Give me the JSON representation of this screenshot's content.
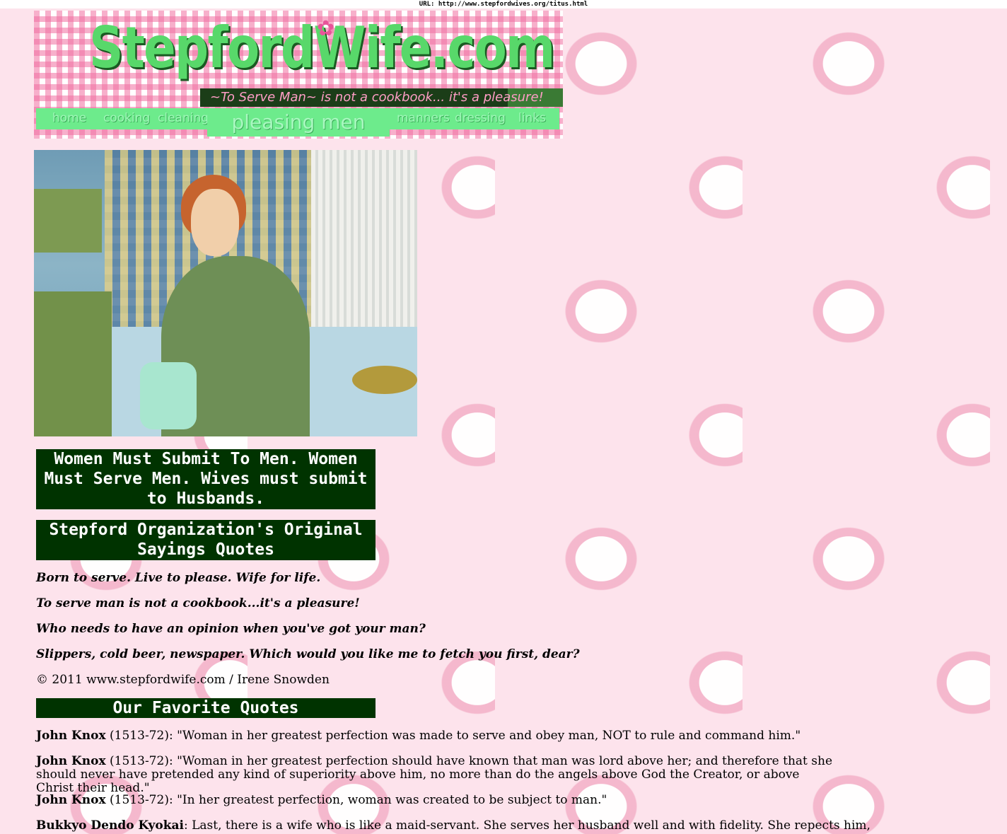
{
  "url_bar": "URL: http://www.stepfordwives.org/titus.html",
  "header": {
    "logo": "StepfordWife.com",
    "tagline": "~To Serve Man~ is not a cookbook... it's a pleasure!",
    "nav": [
      "home",
      "cooking",
      "cleaning",
      "pleasing men",
      "manners",
      "dressing",
      "links"
    ],
    "active": "pleasing men"
  },
  "photo": {
    "alt": "Woman in green dress holding a toilet paper roll in a bathroom"
  },
  "headings": {
    "submit": "Women Must Submit To Men. Women Must Serve Men. Wives must submit to Husbands.",
    "original": "Stepford Organization's Original Sayings Quotes",
    "favorite": "Our Favorite Quotes"
  },
  "sayings": [
    "Born to serve. Live to please. Wife for life.",
    "To serve man is not a cookbook...it's a pleasure!",
    "Who needs to have an opinion when you've got your man?",
    "Slippers, cold beer, newspaper. Which would you like me to fetch you first, dear?"
  ],
  "copyright": "© 2011 www.stepfordwife.com / Irene Snowden",
  "quotes": [
    {
      "author": "John Knox",
      "text": " (1513-72): \"Woman in her greatest perfection was made to serve and obey man, NOT to rule and command him.\""
    },
    {
      "author": "John Knox",
      "text": " (1513-72): \"Woman in her greatest perfection should have known that man was lord above her; and therefore that she should never have pretended any kind of superiority above him, no more than do the angels above God the Creator, or above Christ their head.\""
    },
    {
      "author": "John Knox",
      "text": " (1513-72): \"In her greatest perfection, woman was created to be subject to man.\""
    },
    {
      "author": "Bukkyo Dendo Kyokai",
      "text": ": Last, there is a wife who is like a maid-servant. She serves her husband well and with fidelity. She repects him,"
    }
  ]
}
